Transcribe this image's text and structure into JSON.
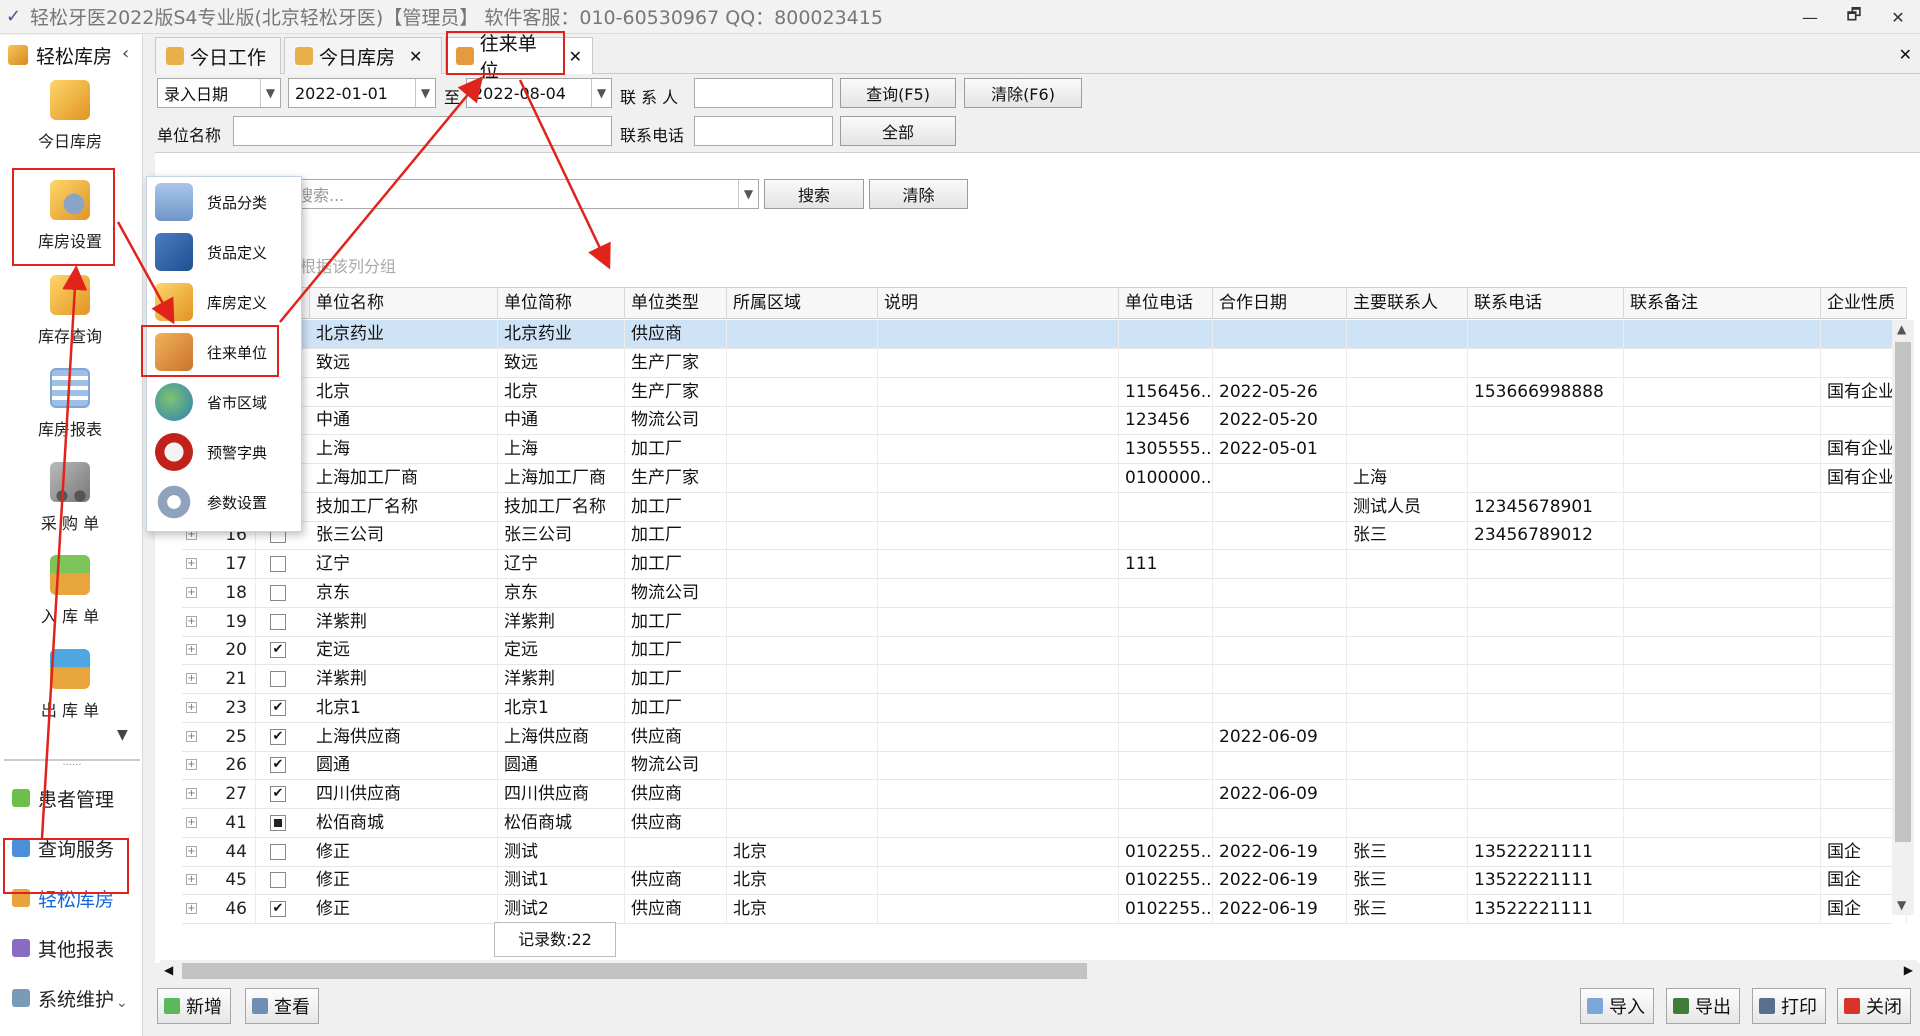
{
  "window": {
    "title": "轻松牙医2022版S4专业版(北京轻松牙医)【管理员】 软件客服：010-60530967 QQ：800023415",
    "buttons": [
      "—",
      "🗗",
      "✕"
    ]
  },
  "sidebar": {
    "header": "轻松库房",
    "items": [
      {
        "label": "今日库房",
        "icon": "warehouse-box-icon"
      },
      {
        "label": "库房设置",
        "icon": "warehouse-settings-icon"
      },
      {
        "label": "库存查询",
        "icon": "inventory-query-icon"
      },
      {
        "label": "库房报表",
        "icon": "report-icon"
      },
      {
        "label": "采 购 单",
        "icon": "cart-icon"
      },
      {
        "label": "入 库 单",
        "icon": "stock-in-icon"
      },
      {
        "label": "出 库 单",
        "icon": "stock-out-icon"
      }
    ],
    "dots": "......",
    "modules": [
      {
        "label": "患者管理"
      },
      {
        "label": "查询服务"
      },
      {
        "label": "轻松库房"
      },
      {
        "label": "其他报表"
      },
      {
        "label": "系统维护"
      }
    ]
  },
  "tabs": [
    {
      "label": "今日工作"
    },
    {
      "label": "今日库房"
    },
    {
      "label": "往来单位"
    }
  ],
  "filters": {
    "date_type": "录入日期",
    "date_from": "2022-01-01",
    "to_label": "至",
    "date_to": "2022-08-04",
    "contact_label": "联 系 人",
    "contact_value": "",
    "query_btn": "查询(F5)",
    "clear_btn": "清除(F6)",
    "unit_name_label": "单位名称",
    "unit_name_value": "",
    "phone_label": "联系电话",
    "phone_value": "",
    "all_btn": "全部",
    "search_placeholder": "搜索...",
    "search_btn": "搜索",
    "search_clear_btn": "清除",
    "group_hint": "根据该列分组"
  },
  "popup_menu": [
    {
      "label": "货品分类"
    },
    {
      "label": "货品定义"
    },
    {
      "label": "库房定义"
    },
    {
      "label": "往来单位"
    },
    {
      "label": "省市区域"
    },
    {
      "label": "预警字典"
    },
    {
      "label": "参数设置"
    }
  ],
  "table": {
    "columns": [
      "单位名称",
      "单位简称",
      "单位类型",
      "所属区域",
      "说明",
      "单位电话",
      "合作日期",
      "主要联系人",
      "联系电话",
      "联系备注",
      "企业性质"
    ],
    "rows": [
      {
        "id": "",
        "chk": "",
        "cells": [
          "北京药业",
          "北京药业",
          "供应商",
          "",
          "",
          "",
          "",
          "",
          "",
          "",
          ""
        ]
      },
      {
        "id": "",
        "chk": "",
        "cells": [
          "致远",
          "致远",
          "生产厂家",
          "",
          "",
          "",
          "",
          "",
          "",
          "",
          ""
        ]
      },
      {
        "id": "",
        "chk": "",
        "cells": [
          "北京",
          "北京",
          "生产厂家",
          "",
          "",
          "1156456...",
          "2022-05-26",
          "",
          "153666998888",
          "",
          "国有企业"
        ]
      },
      {
        "id": "",
        "chk": "",
        "cells": [
          "中通",
          "中通",
          "物流公司",
          "",
          "",
          "123456",
          "2022-05-20",
          "",
          "",
          "",
          ""
        ]
      },
      {
        "id": "",
        "chk": "",
        "cells": [
          "上海",
          "上海",
          "加工厂",
          "",
          "",
          "1305555...",
          "2022-05-01",
          "",
          "",
          "",
          "国有企业"
        ]
      },
      {
        "id": "",
        "chk": "",
        "cells": [
          "上海加工厂商",
          "上海加工厂商",
          "生产厂家",
          "",
          "",
          "0100000...",
          "",
          "上海",
          "",
          "",
          "国有企业"
        ]
      },
      {
        "id": "",
        "chk": "",
        "cells": [
          "技加工厂名称",
          "技加工厂名称",
          "加工厂",
          "",
          "",
          "",
          "",
          "测试人员",
          "12345678901",
          "",
          ""
        ]
      },
      {
        "id": "16",
        "chk": "off",
        "cells": [
          "张三公司",
          "张三公司",
          "加工厂",
          "",
          "",
          "",
          "",
          "张三",
          "23456789012",
          "",
          ""
        ]
      },
      {
        "id": "17",
        "chk": "off",
        "cells": [
          "辽宁",
          "辽宁",
          "加工厂",
          "",
          "",
          "111",
          "",
          "",
          "",
          "",
          ""
        ]
      },
      {
        "id": "18",
        "chk": "off",
        "cells": [
          "京东",
          "京东",
          "物流公司",
          "",
          "",
          "",
          "",
          "",
          "",
          "",
          ""
        ]
      },
      {
        "id": "19",
        "chk": "off",
        "cells": [
          "洋紫荆",
          "洋紫荆",
          "加工厂",
          "",
          "",
          "",
          "",
          "",
          "",
          "",
          ""
        ]
      },
      {
        "id": "20",
        "chk": "on",
        "cells": [
          "定远",
          "定远",
          "加工厂",
          "",
          "",
          "",
          "",
          "",
          "",
          "",
          ""
        ]
      },
      {
        "id": "21",
        "chk": "off",
        "cells": [
          "洋紫荆",
          "洋紫荆",
          "加工厂",
          "",
          "",
          "",
          "",
          "",
          "",
          "",
          ""
        ]
      },
      {
        "id": "23",
        "chk": "on",
        "cells": [
          "北京1",
          "北京1",
          "加工厂",
          "",
          "",
          "",
          "",
          "",
          "",
          "",
          ""
        ]
      },
      {
        "id": "25",
        "chk": "on",
        "cells": [
          "上海供应商",
          "上海供应商",
          "供应商",
          "",
          "",
          "",
          "2022-06-09",
          "",
          "",
          "",
          ""
        ]
      },
      {
        "id": "26",
        "chk": "on",
        "cells": [
          "圆通",
          "圆通",
          "物流公司",
          "",
          "",
          "",
          "",
          "",
          "",
          "",
          ""
        ]
      },
      {
        "id": "27",
        "chk": "on",
        "cells": [
          "四川供应商",
          "四川供应商",
          "供应商",
          "",
          "",
          "",
          "2022-06-09",
          "",
          "",
          "",
          ""
        ]
      },
      {
        "id": "41",
        "chk": "ind",
        "cells": [
          "松佰商城",
          "松佰商城",
          "供应商",
          "",
          "",
          "",
          "",
          "",
          "",
          "",
          ""
        ]
      },
      {
        "id": "44",
        "chk": "off",
        "cells": [
          "修正",
          "测试",
          "",
          "北京",
          "",
          "0102255...",
          "2022-06-19",
          "张三",
          "13522221111",
          "",
          "国企"
        ]
      },
      {
        "id": "45",
        "chk": "off",
        "cells": [
          "修正",
          "测试1",
          "供应商",
          "北京",
          "",
          "0102255...",
          "2022-06-19",
          "张三",
          "13522221111",
          "",
          "国企"
        ]
      },
      {
        "id": "46",
        "chk": "on",
        "cells": [
          "修正",
          "测试2",
          "供应商",
          "北京",
          "",
          "0102255...",
          "2022-06-19",
          "张三",
          "13522221111",
          "",
          "国企"
        ]
      }
    ],
    "record_count": "记录数:22"
  },
  "toolbar": {
    "add": "新增",
    "view": "查看",
    "import": "导入",
    "export": "导出",
    "print": "打印",
    "close": "关闭"
  },
  "colors": {
    "annotation_red": "#e0231b",
    "selected_row": "#cfe3f6",
    "active_module": "#1565d8"
  }
}
